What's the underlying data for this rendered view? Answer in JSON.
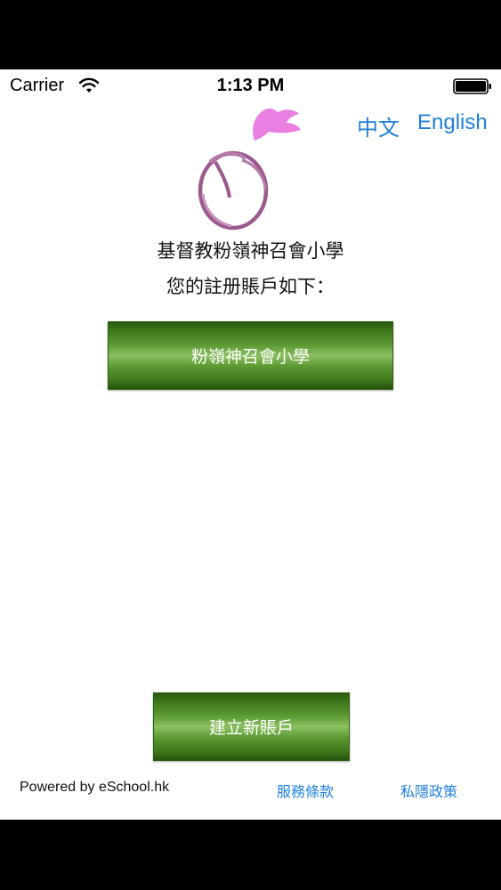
{
  "status_bar": {
    "carrier": "Carrier",
    "time": "1:13 PM",
    "wifi_icon": "wifi-icon",
    "battery_icon": "battery-icon"
  },
  "language": {
    "chinese": "中文",
    "english": "English"
  },
  "logo_icon": "school-logo-icon",
  "school": {
    "name": "基督教粉嶺神召會小學",
    "prompt": "您的註册賬戶如下："
  },
  "accounts": [
    {
      "label": "粉嶺神召會小學"
    }
  ],
  "create_account_label": "建立新賬戶",
  "footer": {
    "powered_by": "Powered by eSchool.hk",
    "terms": "服務條款",
    "privacy": "私隱政策"
  },
  "colors": {
    "link": "#1f7fdc",
    "button_green": "#4a8a24",
    "logo_pink": "#e97fe0",
    "logo_purple": "#9b5a8e"
  }
}
